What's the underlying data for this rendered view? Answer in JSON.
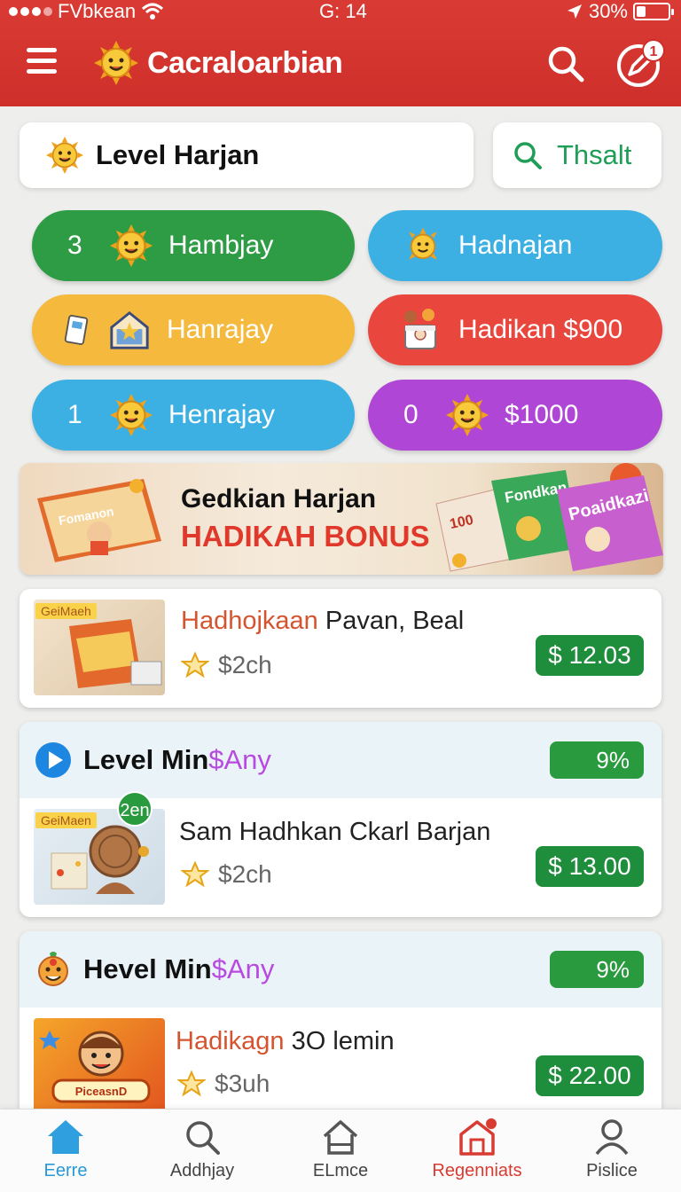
{
  "status_bar": {
    "carrier": "FVbkean",
    "time": "G: 14",
    "battery_text": "30%",
    "battery_level": 0.3
  },
  "header": {
    "title": "Cacraloarbian",
    "notification_count": "1"
  },
  "search": {
    "level_label": "Level Harjan",
    "search_button": "Thsalt"
  },
  "quick_buttons": [
    {
      "number": "3",
      "label": "Hambjay",
      "color": "#2e9c44"
    },
    {
      "number": "",
      "label": "Hadnajan",
      "color": "#3cb0e3"
    },
    {
      "number": "",
      "label": "Hanrajay",
      "color": "#f5b93d"
    },
    {
      "number": "",
      "label": "Hadikan $900",
      "color": "#e9473d"
    },
    {
      "number": "1",
      "label": "Henrajay",
      "color": "#3cb0e3"
    },
    {
      "number": "0",
      "label": "$1000",
      "color": "#b046d6"
    }
  ],
  "banner": {
    "title": "Gedkian Harjan",
    "subtitle": "HADIKAH BONUS",
    "book_left": "Fomanon",
    "book_right_1": "Fondkan",
    "book_right_2": "Poaidkazi",
    "book_mid": "100"
  },
  "items": [
    {
      "thumb_tag": "GeiMaeh",
      "title_highlight": "Hadhojkaan",
      "title_rest": " Pavan, Beal",
      "rating": "$2ch",
      "price": "$ 12.03"
    }
  ],
  "sections": [
    {
      "heading_main": "Level Min",
      "heading_accent": "$Any",
      "percent": "9%",
      "item": {
        "thumb_tag": "GeiMaen",
        "badge": "2en",
        "title": "Sam Hadhkan Ckarl Barjan",
        "rating": "$2ch",
        "price": "$ 13.00"
      }
    },
    {
      "heading_main": "Hevel Min",
      "heading_accent": "$Any",
      "percent": "9%",
      "item": {
        "thumb_label": "PiceasnD",
        "title_highlight": "Hadikagn",
        "title_rest": " 3O lemin",
        "rating": "$3uh",
        "price": "$ 22.00"
      }
    }
  ],
  "bottom_nav": [
    {
      "label": "Eerre",
      "icon": "home-icon",
      "color": "#2799d6"
    },
    {
      "label": "Addhjay",
      "icon": "search-icon",
      "color": "#444444"
    },
    {
      "label": "ELmce",
      "icon": "house-outline-icon",
      "color": "#444444"
    },
    {
      "label": "Regenniats",
      "icon": "store-icon",
      "color": "#d83b31"
    },
    {
      "label": "Pislice",
      "icon": "profile-icon",
      "color": "#444444"
    }
  ]
}
